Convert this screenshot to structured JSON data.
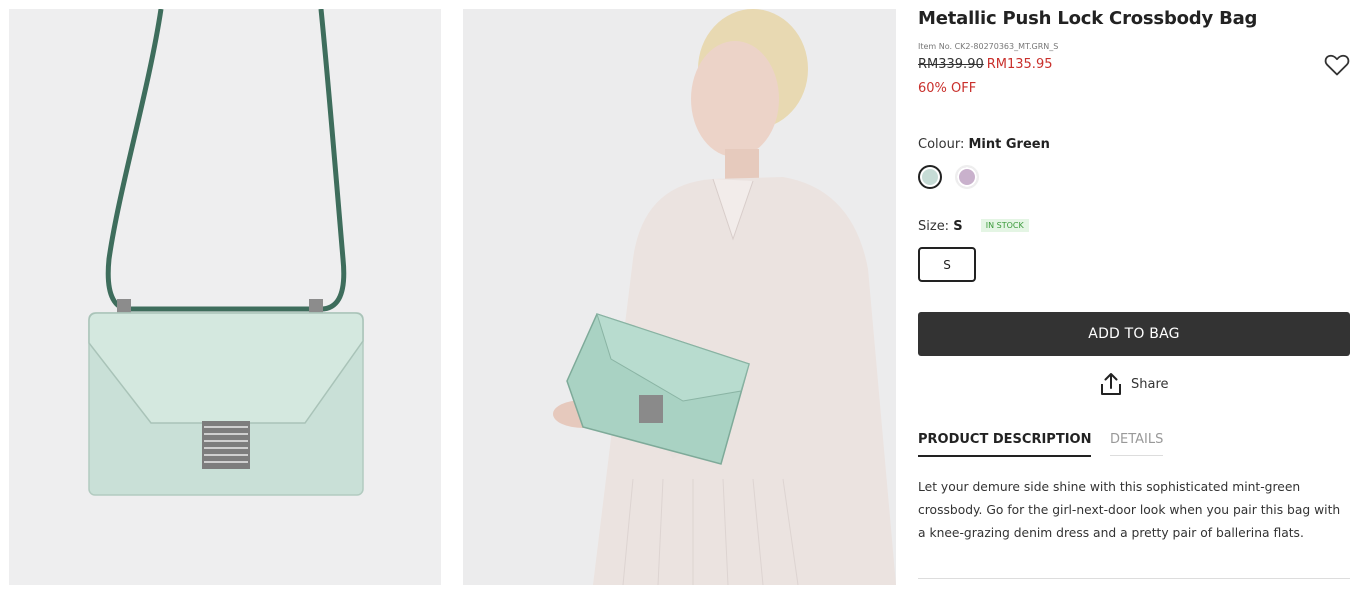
{
  "product": {
    "title": "Metallic Push Lock Crossbody Bag",
    "item_no": "Item No. CK2-80270363_MT.GRN_S",
    "price_original": "RM339.90",
    "price_sale": "RM135.95",
    "discount": "60% OFF"
  },
  "colour": {
    "label": "Colour:",
    "selected": "Mint Green",
    "swatches": [
      "#c6dcd6",
      "#c9b1cc"
    ]
  },
  "size": {
    "label": "Size:",
    "selected": "S",
    "stock_badge": "IN STOCK",
    "options": [
      "S"
    ]
  },
  "actions": {
    "add_to_bag": "ADD TO BAG",
    "share": "Share"
  },
  "tabs": {
    "description": "PRODUCT DESCRIPTION",
    "details": "DETAILS"
  },
  "description_text": "Let your demure side shine with this sophisticated mint-green crossbody. Go for the girl-next-door look when you pair this bag with a knee-grazing denim dress and a pretty pair of ballerina flats.",
  "icons": {
    "wishlist": "heart-icon",
    "share": "share-icon"
  }
}
